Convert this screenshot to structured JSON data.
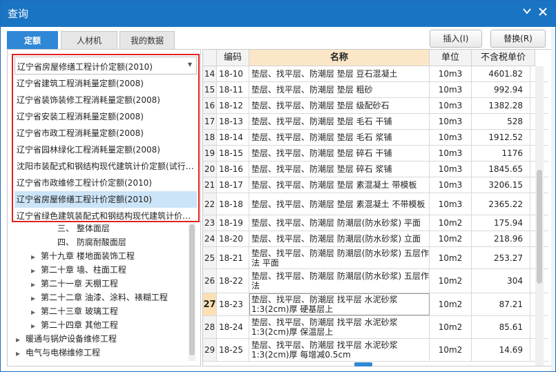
{
  "window": {
    "title": "查询",
    "minimize_icon": "chevron-down-icon",
    "close_icon": "close-icon"
  },
  "tabs": [
    {
      "label": "定额",
      "active": true
    },
    {
      "label": "人材机",
      "active": false
    },
    {
      "label": "我的数据",
      "active": false
    }
  ],
  "toolbar": {
    "insert_label": "插入(I)",
    "replace_label": "替换(R)"
  },
  "library_select": {
    "value": "辽宁省房屋修缮工程计价定额(2010)"
  },
  "library_options": [
    "辽宁省建筑工程消耗量定额(2008)",
    "辽宁省装饰装修工程消耗量定额(2008)",
    "辽宁省安装工程消耗量定额(2008)",
    "辽宁省市政工程消耗量定额(2008)",
    "辽宁省园林绿化工程消耗量定额(2008)",
    "沈阳市装配式和钢结构现代建筑计价定额(试行…",
    "辽宁省市政维修工程计价定额(2010)",
    "辽宁省房屋修缮工程计价定额(2010)",
    "辽宁省绿色建筑装配式和钢结构现代建筑计价…"
  ],
  "tree": [
    {
      "label": "三、 整体面层",
      "arrow": false
    },
    {
      "label": "四、 防腐耐酸面层",
      "arrow": false
    },
    {
      "label": "第十九章 楼地面装饰工程",
      "arrow": true
    },
    {
      "label": "第二十章 墙、柱面工程",
      "arrow": true
    },
    {
      "label": "第二十一章 天棚工程",
      "arrow": true
    },
    {
      "label": "第二十二章 油漆、涂料、裱糊工程",
      "arrow": true
    },
    {
      "label": "第二十三章 玻璃工程",
      "arrow": true
    },
    {
      "label": "第二十四章 其他工程",
      "arrow": true
    },
    {
      "label": "暖通与锅炉设备维修工程",
      "arrow": true
    },
    {
      "label": "电气与电梯维修工程",
      "arrow": true
    }
  ],
  "table": {
    "headers": {
      "code": "编码",
      "name": "名称",
      "unit": "单位",
      "price": "不含税单价"
    },
    "rows": [
      {
        "num": "14",
        "code": "18-10",
        "name": "垫层、找平层、防潮层 垫层 豆石混凝土",
        "unit": "10m3",
        "price": "4601.82"
      },
      {
        "num": "15",
        "code": "18-11",
        "name": "垫层、找平层、防潮层 垫层 粗砂",
        "unit": "10m3",
        "price": "992.94"
      },
      {
        "num": "16",
        "code": "18-12",
        "name": "垫层、找平层、防潮层 垫层 级配砂石",
        "unit": "10m3",
        "price": "1382.28"
      },
      {
        "num": "17",
        "code": "18-13",
        "name": "垫层、找平层、防潮层 垫层 毛石 干铺",
        "unit": "10m3",
        "price": "528"
      },
      {
        "num": "18",
        "code": "18-14",
        "name": "垫层、找平层、防潮层 垫层 毛石 浆铺",
        "unit": "10m3",
        "price": "1912.52"
      },
      {
        "num": "19",
        "code": "18-15",
        "name": "垫层、找平层、防潮层 垫层 碎石 干铺",
        "unit": "10m3",
        "price": "1176"
      },
      {
        "num": "20",
        "code": "18-16",
        "name": "垫层、找平层、防潮层 垫层 碎石 浆铺",
        "unit": "10m3",
        "price": "1845.65"
      },
      {
        "num": "21",
        "code": "18-17",
        "name": "垫层、找平层、防潮层 垫层 素混凝土 带模板",
        "unit": "10m3",
        "price": "3206.15"
      },
      {
        "num": "22",
        "code": "18-18",
        "name": "垫层、找平层、防潮层 垫层 素混凝土 不带模板",
        "unit": "10m3",
        "price": "2365.22"
      },
      {
        "num": "23",
        "code": "18-19",
        "name": "垫层、找平层、防潮层 防潮层(防水砂浆) 平面",
        "unit": "10m2",
        "price": "175.94"
      },
      {
        "num": "24",
        "code": "18-20",
        "name": "垫层、找平层、防潮层 防潮层(防水砂浆) 立面",
        "unit": "10m2",
        "price": "218.96"
      },
      {
        "num": "25",
        "code": "18-21",
        "name": "垫层、找平层、防潮层 防潮层(防水砂浆) 五层作法 平面",
        "unit": "10m2",
        "price": "253.27"
      },
      {
        "num": "26",
        "code": "18-22",
        "name": "垫层、找平层、防潮层 防潮层(防水砂浆) 五层作法",
        "unit": "10m2",
        "price": "304"
      },
      {
        "num": "27",
        "code": "18-23",
        "name": "垫层、找平层、防潮层 找平层 水泥砂浆 1:3(2cm)厚 硬基层上",
        "unit": "10m2",
        "price": "87.21"
      },
      {
        "num": "28",
        "code": "18-24",
        "name": "垫层、找平层、防潮层 找平层 水泥砂浆 1:3(2cm)厚 保温层上",
        "unit": "10m2",
        "price": "85.61"
      },
      {
        "num": "29",
        "code": "18-25",
        "name": "垫层、找平层、防潮层 找平层 水泥砂浆 1:3(2cm)厚 每增减0.5cm",
        "unit": "10m2",
        "price": "14.69"
      }
    ]
  },
  "colors": {
    "titlebar": "#1a74c4",
    "tab_active": "#2f87d5",
    "highlight": "#e02020",
    "name_header": "#fbe7c7",
    "selected_option": "#cce4f7"
  }
}
